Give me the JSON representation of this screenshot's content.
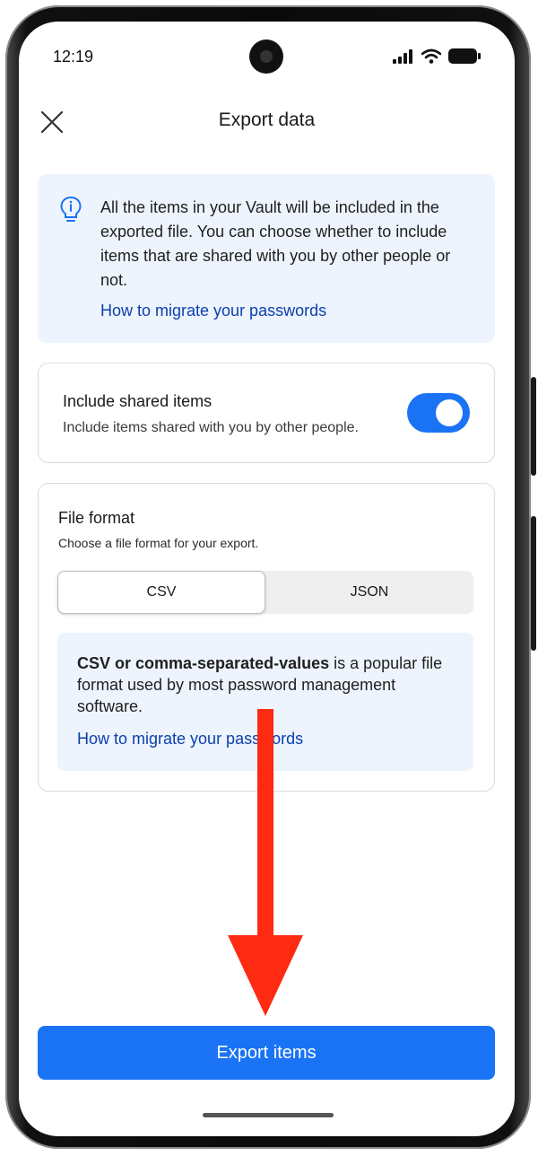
{
  "status_bar": {
    "time": "12:19"
  },
  "header": {
    "title": "Export data",
    "close_icon": "close-icon"
  },
  "info": {
    "icon": "lightbulb-icon",
    "text": "All the items in your Vault will be included in the exported file. You can choose whether to include items that are shared with you by other people or not.",
    "link": "How to migrate your passwords"
  },
  "shared": {
    "title": "Include shared items",
    "subtitle": "Include items shared with you by other people.",
    "enabled": true
  },
  "file_format": {
    "title": "File format",
    "subtitle": "Choose a file format for your export.",
    "options": [
      "CSV",
      "JSON"
    ],
    "selected": "CSV",
    "description_bold": "CSV or comma-separated-values",
    "description_rest": " is a popular file format used by most password management software.",
    "link": "How to migrate your passwords"
  },
  "export_button": "Export items",
  "colors": {
    "accent": "#1a73f5",
    "link": "#0a3fae",
    "info_bg": "#eef4fd",
    "annotation_arrow": "#ff2a12"
  }
}
